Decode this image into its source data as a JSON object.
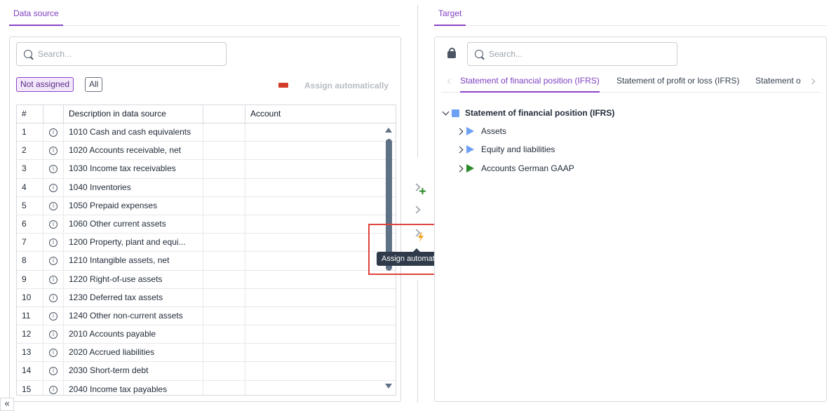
{
  "left_tab": {
    "label": "Data source"
  },
  "right_tab": {
    "label": "Target"
  },
  "source": {
    "search_placeholder": "Search...",
    "filter_not_assigned": "Not assigned",
    "filter_all": "All",
    "assign_auto_label": "Assign automatically",
    "columns": [
      "#",
      "",
      "Description in data source",
      "",
      "Account"
    ],
    "rows": [
      {
        "num": "1",
        "desc": "1010 Cash and cash equivalents",
        "account": ""
      },
      {
        "num": "2",
        "desc": "1020 Accounts receivable, net",
        "account": ""
      },
      {
        "num": "3",
        "desc": "1030 Income tax receivables",
        "account": ""
      },
      {
        "num": "4",
        "desc": "1040 Inventories",
        "account": ""
      },
      {
        "num": "5",
        "desc": "1050 Prepaid expenses",
        "account": ""
      },
      {
        "num": "6",
        "desc": "1060 Other current assets",
        "account": ""
      },
      {
        "num": "7",
        "desc": "1200 Property, plant and equi...",
        "account": ""
      },
      {
        "num": "8",
        "desc": "1210 Intangible assets, net",
        "account": ""
      },
      {
        "num": "9",
        "desc": "1220 Right-of-use assets",
        "account": ""
      },
      {
        "num": "10",
        "desc": "1230 Deferred tax assets",
        "account": ""
      },
      {
        "num": "11",
        "desc": "1240 Other non-current assets",
        "account": ""
      },
      {
        "num": "12",
        "desc": "2010 Accounts payable",
        "account": ""
      },
      {
        "num": "13",
        "desc": "2020 Accrued liabilities",
        "account": ""
      },
      {
        "num": "14",
        "desc": "2030 Short-term debt",
        "account": ""
      },
      {
        "num": "15",
        "desc": "2040 Income tax payables",
        "account": ""
      }
    ]
  },
  "middle": {
    "tooltip": "Assign automatically"
  },
  "target": {
    "search_placeholder": "Search...",
    "tabs": [
      "Statement of financial position (IFRS)",
      "Statement of profit or loss (IFRS)",
      "Statement o"
    ],
    "tree": {
      "root": "Statement of financial position (IFRS)",
      "children": [
        "Assets",
        "Equity and liabilities",
        "Accounts German GAAP"
      ]
    }
  },
  "colors": {
    "accent": "#8b44c9",
    "assign_swatch": "#d33b2a",
    "highlight": "#e0443e",
    "tree_blue": "#6ea0f5",
    "tree_green": "#2a8a2a",
    "bolt": "#f0a020",
    "plus": "#2a8a2a"
  }
}
